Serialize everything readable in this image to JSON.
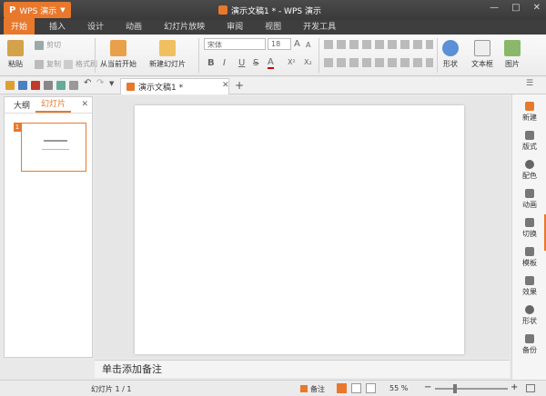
{
  "app": {
    "menu_label": "WPS 演示",
    "logo": "P",
    "window_title": "演示文稿1 * - WPS 演示"
  },
  "window_controls": [
    "—",
    "□",
    "✕"
  ],
  "tabs": [
    "开始",
    "插入",
    "设计",
    "动画",
    "幻灯片放映",
    "审阅",
    "视图",
    "开发工具"
  ],
  "ribbon": {
    "paste": "粘贴",
    "cut": "剪切",
    "copy": "复制",
    "format_painter": "格式刷",
    "from_current": "从当前开始",
    "new_slide": "新建幻灯片",
    "font_name": "宋体",
    "font_size": "18",
    "shapes": "形状",
    "textbox": "文本框",
    "picture": "图片",
    "format_buttons": [
      "B",
      "I",
      "U",
      "S",
      "A",
      "X²",
      "X₂"
    ],
    "grow_font": "A",
    "shrink_font": "A"
  },
  "doc_tab": {
    "title": "演示文稿1 *"
  },
  "left_panel": {
    "tabs": [
      "大纲",
      "幻灯片"
    ],
    "slide_number": "1"
  },
  "notes_placeholder": "单击添加备注",
  "right_pane": [
    "新建",
    "版式",
    "配色",
    "动画",
    "切换",
    "模板",
    "效果",
    "形状",
    "备份"
  ],
  "status": {
    "slide_info": "幻灯片 1 / 1",
    "notes": "备注",
    "zoom": "55 %",
    "zoom_percent": 55
  },
  "colors": {
    "accent": "#e8782c",
    "titlebar": "#3a3a3a"
  }
}
